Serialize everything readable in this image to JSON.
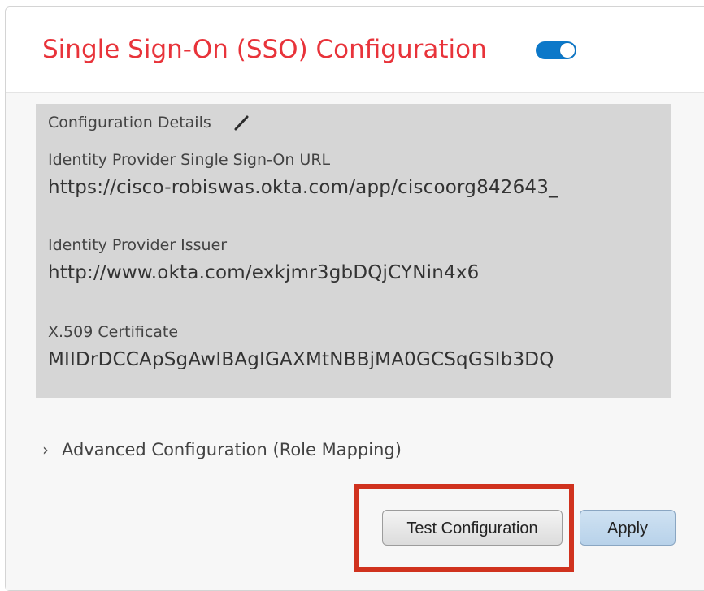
{
  "header": {
    "title": "Single Sign-On (SSO) Configuration",
    "toggle_state": "on",
    "toggle_color": "#0c78c9",
    "title_color": "#e8333a"
  },
  "details": {
    "section_label": "Configuration Details",
    "edit_icon": "pencil-icon",
    "fields": [
      {
        "label": "Identity Provider Single Sign-On URL",
        "value": "https://cisco-robiswas.okta.com/app/ciscoorg842643_"
      },
      {
        "label": "Identity Provider Issuer",
        "value": "http://www.okta.com/exkjmr3gbDQjCYNin4x6"
      },
      {
        "label": "X.509 Certificate",
        "value": "MIIDrDCCApSgAwIBAgIGAXMtNBBjMA0GCSqGSIb3DQ"
      }
    ]
  },
  "advanced": {
    "icon": "chevron-right-icon",
    "label": "Advanced Configuration (Role Mapping)"
  },
  "actions": {
    "test_label": "Test Configuration",
    "apply_label": "Apply",
    "highlight_color": "#d0321e"
  }
}
